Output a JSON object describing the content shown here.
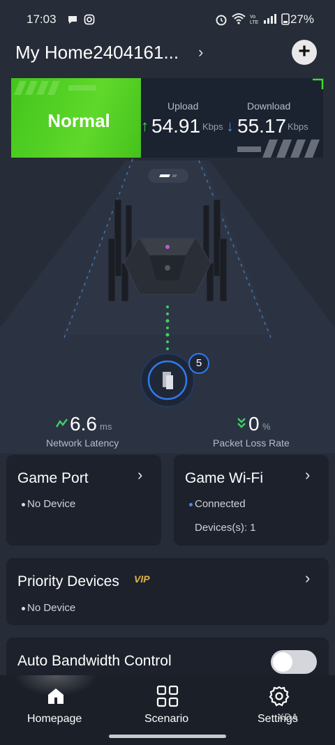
{
  "status_bar": {
    "time": "17:03",
    "battery": "27%"
  },
  "header": {
    "title": "My Home2404161...",
    "add_label": "+"
  },
  "network_status": {
    "state": "Normal",
    "upload_label": "Upload",
    "upload_value": "54.91",
    "upload_unit": "Kbps",
    "download_label": "Download",
    "download_value": "55.17",
    "download_unit": "Kbps"
  },
  "device_count": "5",
  "metrics": {
    "latency_value": "6.6",
    "latency_unit": "ms",
    "latency_label": "Network Latency",
    "loss_value": "0",
    "loss_unit": "%",
    "loss_label": "Packet Loss Rate"
  },
  "cards": {
    "game_port": {
      "title": "Game Port",
      "status": "No Device"
    },
    "game_wifi": {
      "title": "Game Wi-Fi",
      "status": "Connected",
      "devices": "Devices(s): 1"
    },
    "priority": {
      "title": "Priority Devices",
      "badge": "VIP",
      "status": "No Device"
    },
    "bandwidth": {
      "title": "Auto Bandwidth Control",
      "enabled": false
    }
  },
  "nav": {
    "items": [
      {
        "label": "Homepage"
      },
      {
        "label": "Scenario"
      },
      {
        "label": "Settings"
      }
    ]
  },
  "watermark": "XDA",
  "colors": {
    "accent_green": "#4ccb1e",
    "accent_blue": "#3f8bff",
    "background": "#262c38"
  }
}
